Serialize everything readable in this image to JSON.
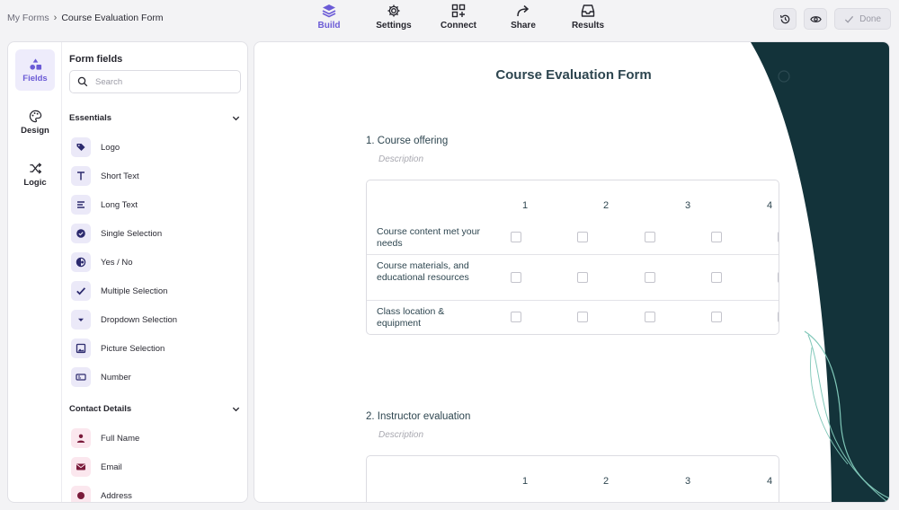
{
  "breadcrumb": {
    "root": "My Forms",
    "separator": "›",
    "current": "Course Evaluation Form"
  },
  "nav": [
    {
      "label": "Build",
      "icon": "layers-icon",
      "active": true
    },
    {
      "label": "Settings",
      "icon": "gear-icon"
    },
    {
      "label": "Connect",
      "icon": "grid-plus-icon"
    },
    {
      "label": "Share",
      "icon": "share-arrow-icon"
    },
    {
      "label": "Results",
      "icon": "inbox-icon"
    }
  ],
  "actions": {
    "history_icon": "history-icon",
    "preview_icon": "eye-icon",
    "done_label": "Done"
  },
  "rail": [
    {
      "label": "Fields",
      "icon": "shapes-icon",
      "active": true
    },
    {
      "label": "Design",
      "icon": "palette-icon"
    },
    {
      "label": "Logic",
      "icon": "shuffle-icon"
    }
  ],
  "panel": {
    "title": "Form fields",
    "search_placeholder": "Search",
    "essentials": {
      "label": "Essentials",
      "items": [
        {
          "label": "Logo",
          "icon": "tag-icon"
        },
        {
          "label": "Short Text",
          "icon": "text-t-icon"
        },
        {
          "label": "Long Text",
          "icon": "paragraph-icon"
        },
        {
          "label": "Single Selection",
          "icon": "radio-check-icon"
        },
        {
          "label": "Yes / No",
          "icon": "half-circle-icon"
        },
        {
          "label": "Multiple Selection",
          "icon": "checkmark-icon"
        },
        {
          "label": "Dropdown Selection",
          "icon": "dropdown-caret-icon"
        },
        {
          "label": "Picture Selection",
          "icon": "image-icon"
        },
        {
          "label": "Number",
          "icon": "number-field-icon"
        }
      ]
    },
    "contact": {
      "label": "Contact Details",
      "items": [
        {
          "label": "Full Name",
          "icon": "person-icon"
        },
        {
          "label": "Email",
          "icon": "envelope-icon"
        },
        {
          "label": "Address",
          "icon": "location-icon"
        }
      ]
    }
  },
  "form": {
    "title": "Course Evaluation Form",
    "questions": [
      {
        "number": "1.",
        "title": "Course offering",
        "description_placeholder": "Description",
        "columns": [
          "1",
          "2",
          "3",
          "4"
        ],
        "rows": [
          "Course content met your needs",
          "Course materials, and educational resources",
          "Class location & equipment"
        ]
      },
      {
        "number": "2.",
        "title": "Instructor evaluation",
        "description_placeholder": "Description",
        "columns": [
          "1",
          "2",
          "3",
          "4"
        ]
      }
    ]
  },
  "colors": {
    "accent": "#6b5bd6",
    "theme_dark": "#13333a",
    "theme_line": "#7fc7b8"
  }
}
